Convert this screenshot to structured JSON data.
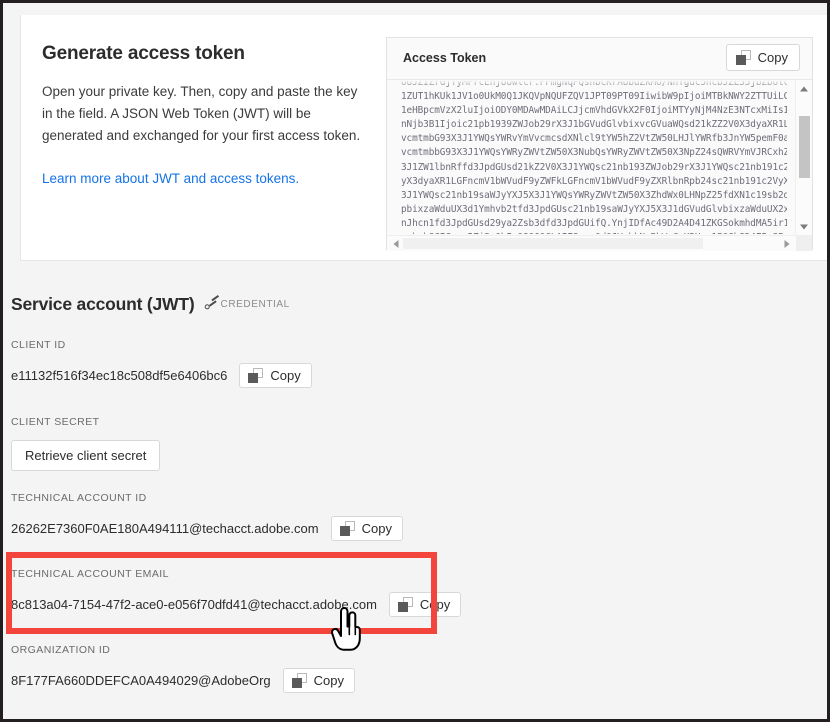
{
  "intro": {
    "title": "Generate access token",
    "body": "Open your private key. Then, copy and paste the key in the field. A JSON Web Token (JWT) will be generated and exchanged for your first access token.",
    "link": "Learn more about JWT and access tokens."
  },
  "token_panel": {
    "label": "Access Token",
    "copy_label": "Copy",
    "token_text": "OUJZIZrGjTyMFrcEnjUUwlcr.FFmgNqPQsnbcKrAUbuZkMo/NnYguc5ncbJZL55jbZbolccuNzy1oI\n1ZUT1hKUk1JV1o0UkM0Q1JKQVpNQUFZQV1JPT09PT09IiwibW9pIjoiMTBkNWY2ZTTUiLCJ\n1eHBpcmVzX2luIjoiODY0MDAwMDAiLCJjcmVhdGVkX2F0IjoiMTYyNjM4NzE3NTcxMiIsI\nnNjb3B1Ijoic21pb1939ZWJob29rX3J1bGVudGlvbixvcGVuaWQsd21kZZ2V0X3dyaXR1LHd\nvcmtmbG93X3J1YWQsYWRvYmVvcmcsdXNlcl9tYW5hZ2VtZW50LHJlYWRfb3JnYW5pemF0aW\nvcmtmbbG93X3J1YWQsYWRyZWVtZW50X3NubQsYWRyZWVtZW50X3NpZ24sQWRVYmVJRCxhZ\n3J1ZW1lbnRffd3JpdGUsd21kZ2V0X3J1YWQsc21nb193ZWJob29rX3J1YWQsc21nb191c2V\nyX3dyaXR1LGFncmV1bWVudF9yZWFkLGFncmV1bWVudF9yZXRlbnRpb24sc21nb191c2VyX\n3J1YWQsc21nb19saWJyYXJ5X3J1YWQsYWRyZWVtZW50X3ZhdWx0LHNpZ25fdXN1c19sb2d\npbixzaWduUX3d1Ymhvb2tfd3JpdGUsc21nb19saWJyYXJ5X3J1dGVudGlvbixzaWduUX2xpY\nnJhcn1fd3JpdGUsd29ya2Zsb3dfd3JpdGUifQ.YnjIDfAc49D2A4D41ZKGSokmhdMA5ir1\nzxbab8GIGwxp5ZjSaOhIxQ8Q60CLAIE8euqOd0JVpbkNeBhWuCyK2Hg_1PQ6h8D4F5nSPy"
  },
  "credential_section": {
    "title": "Service account (JWT)",
    "tag": "CREDENTIAL"
  },
  "fields": [
    {
      "label": "CLIENT ID",
      "value": "e11132f516f34ec18c508df5e6406bc6",
      "action": "Copy",
      "action_type": "copy"
    },
    {
      "label": "CLIENT SECRET",
      "value": "",
      "action": "Retrieve client secret",
      "action_type": "button"
    },
    {
      "label": "TECHNICAL ACCOUNT ID",
      "value": "26262E7360F0AE180A494111@techacct.adobe.com",
      "action": "Copy",
      "action_type": "copy"
    },
    {
      "label": "TECHNICAL ACCOUNT EMAIL",
      "value": "8c813a04-7154-47f2-ace0-e056f70dfd41@techacct.adobe.com",
      "action": "Copy",
      "action_type": "copy"
    },
    {
      "label": "ORGANIZATION ID",
      "value": "8F177FA660DDEFCA0A494029@AdobeOrg",
      "action": "Copy",
      "action_type": "copy"
    }
  ],
  "annotation": {
    "highlight_color": "#f4453c",
    "highlighted_field": "TECHNICAL ACCOUNT EMAIL"
  },
  "colors": {
    "link": "#1473e6",
    "page_background": "#f4f4f4",
    "card_background": "#ffffff",
    "text": "#2c2c2c"
  }
}
